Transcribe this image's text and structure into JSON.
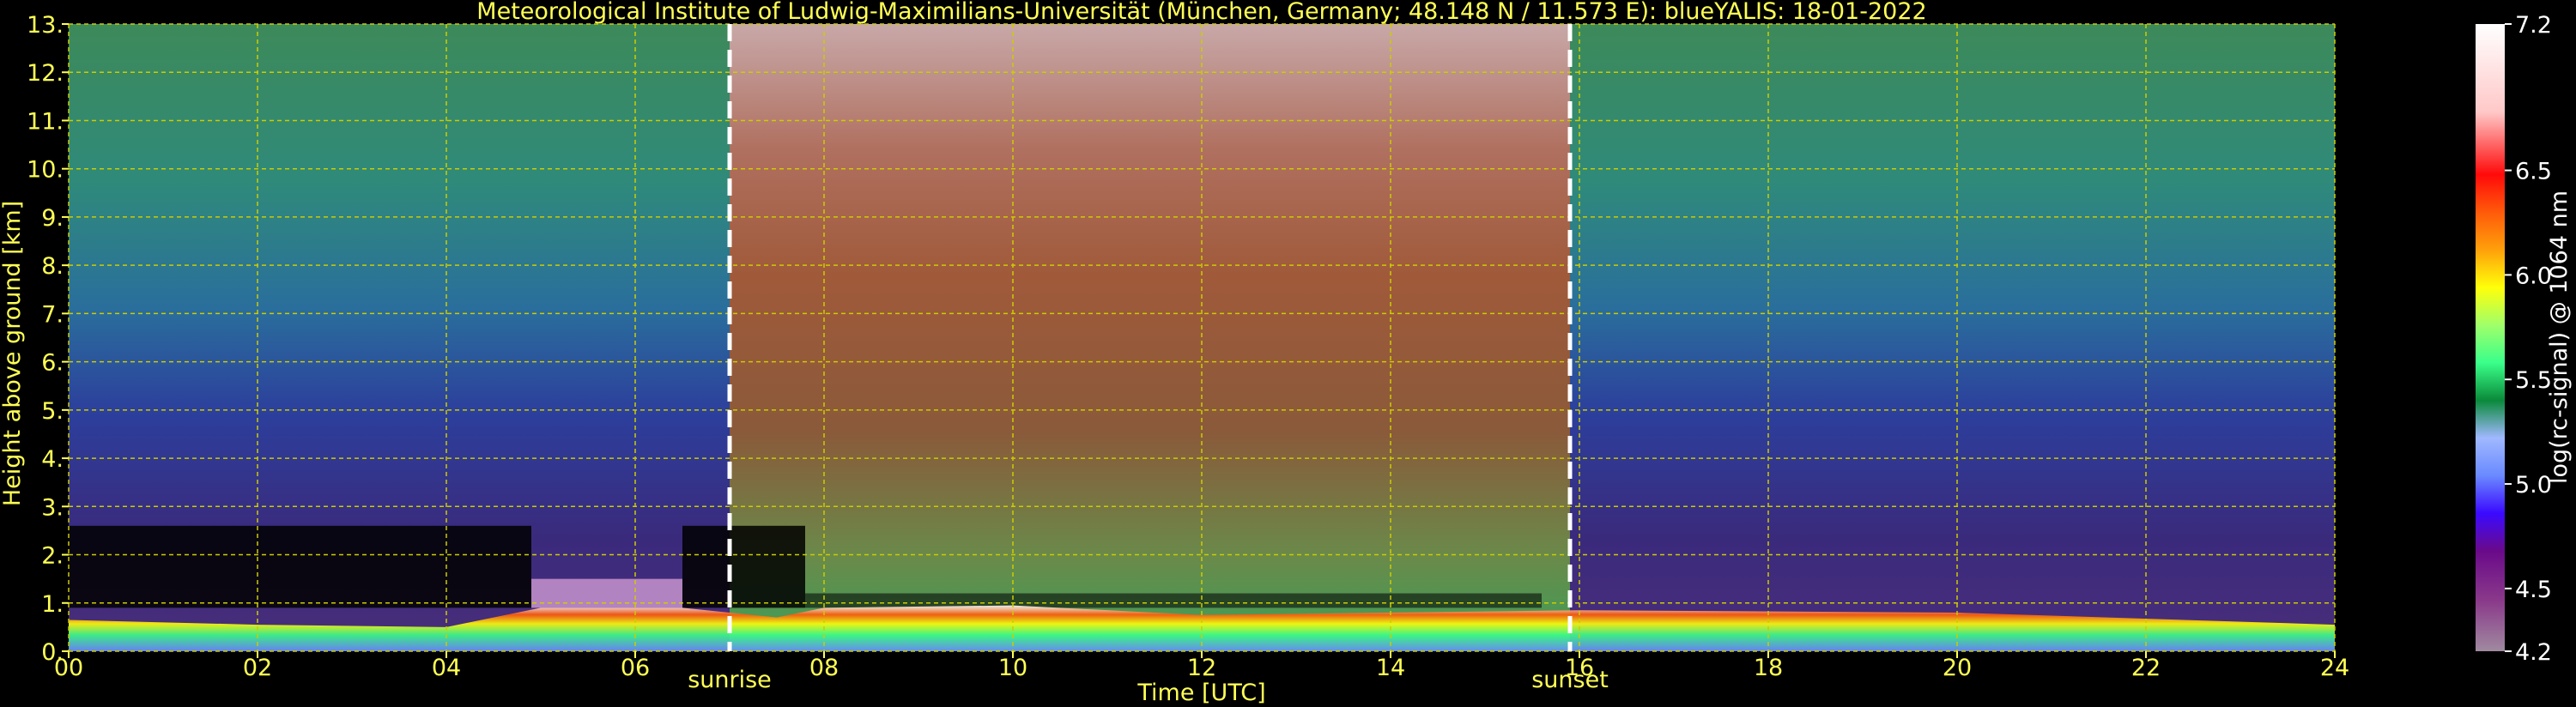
{
  "chart_data": {
    "type": "heatmap",
    "title": "Meteorological Institute of Ludwig-Maximilians-Universität (München, Germany; 48.148 N / 11.573 E):     blueYALIS: 18-01-2022",
    "xlabel": "Time [UTC]",
    "ylabel": "Height above ground [km]",
    "xlim": [
      0,
      24
    ],
    "ylim": [
      0,
      13
    ],
    "xticks": [
      0,
      2,
      4,
      6,
      8,
      10,
      12,
      14,
      16,
      18,
      20,
      22,
      24
    ],
    "xtick_labels": [
      "00",
      "02",
      "04",
      "06",
      "08",
      "10",
      "12",
      "14",
      "16",
      "18",
      "20",
      "22",
      "24"
    ],
    "yticks": [
      0,
      1,
      2,
      3,
      4,
      5,
      6,
      7,
      8,
      9,
      10,
      11,
      12,
      13
    ],
    "ytick_labels": [
      "0.",
      "1.",
      "2.",
      "3.",
      "4.",
      "5.",
      "6.",
      "7.",
      "8.",
      "9.",
      "10.",
      "11.",
      "12.",
      "13."
    ],
    "grid": true,
    "colorbar": {
      "label": "log(rc-signal) @ 1064 nm",
      "range": [
        4.2,
        7.2
      ],
      "ticks": [
        4.2,
        4.5,
        5.0,
        5.5,
        6.0,
        6.5,
        7.2
      ],
      "tick_labels": [
        "4.2",
        "4.5",
        "5.0",
        "5.5",
        "6.0",
        "6.5",
        "7.2"
      ]
    },
    "annotations": [
      {
        "label": "sunrise",
        "x": 7.0
      },
      {
        "label": "sunset",
        "x": 15.9
      }
    ],
    "features": {
      "boundary_layer_top_km": [
        {
          "t": 0,
          "h": 0.65
        },
        {
          "t": 2,
          "h": 0.55
        },
        {
          "t": 4,
          "h": 0.5
        },
        {
          "t": 5,
          "h": 0.9
        },
        {
          "t": 6.5,
          "h": 0.9
        },
        {
          "t": 7.5,
          "h": 0.7
        },
        {
          "t": 8,
          "h": 0.9
        },
        {
          "t": 10,
          "h": 0.95
        },
        {
          "t": 12,
          "h": 0.75
        },
        {
          "t": 14,
          "h": 0.8
        },
        {
          "t": 16,
          "h": 0.85
        },
        {
          "t": 20,
          "h": 0.8
        },
        {
          "t": 24,
          "h": 0.55
        }
      ],
      "daylight_background": [
        7.0,
        15.9
      ]
    }
  },
  "colors": {
    "text": "#ffff55",
    "grid": "#cccc00",
    "sun_lines": "#ffffff",
    "colormap": [
      "#a08aa0",
      "#8a3a8a",
      "#6a0a8a",
      "#3a0aff",
      "#6a8aff",
      "#a0b8ff",
      "#0a8a3a",
      "#3aff8a",
      "#a0ff6a",
      "#ffff0a",
      "#ffa00a",
      "#ff5a0a",
      "#ff0a0a",
      "#ffc8c8",
      "#ffffff"
    ]
  }
}
